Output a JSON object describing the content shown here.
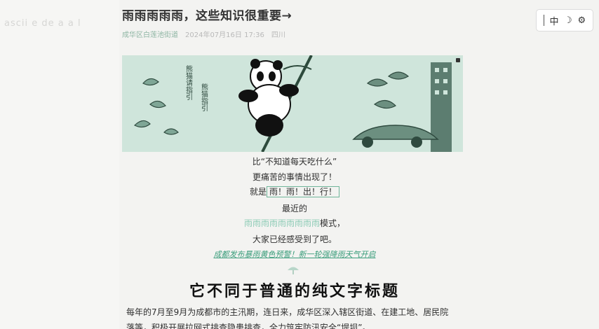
{
  "side": {
    "faded_text": "ascii e de a a l"
  },
  "article": {
    "title": "雨雨雨雨雨，这些知识很重要→",
    "author": "成华区白莲池街道",
    "date": "2024年07月16日 17:36",
    "location": "四川",
    "banner": {
      "vertical_text_1": "熊猫请指引",
      "vertical_text_2": "熊猫指引"
    },
    "lines": [
      "比“不知道每天吃什么”",
      "更痛苦的事情出现了！",
      "就是",
      "雨！雨！出！行！",
      "最近的",
      "雨雨雨雨雨雨雨雨雨",
      "模式，",
      "大家已经感受到了吧。",
      "成都发布暴雨黄色预警！新一轮强降雨天气开启"
    ],
    "subtitle": "它不同于普通的纯文字标题",
    "paragraph": "每年的7月至9月为成都市的主汛期，连日来，成华区深入辖区街道、在建工地、居民院落等，积极开展拉网式排查隐患排查，全力筑牢防汛安全“堤坝”。"
  },
  "toolbar": {
    "ime_label": "中",
    "moon_icon": "moon-icon",
    "settings_icon": "settings-icon"
  },
  "colors": {
    "accent": "#6fb59a",
    "banner_bg": "#cfe5db",
    "link": "#3a9d7b"
  }
}
